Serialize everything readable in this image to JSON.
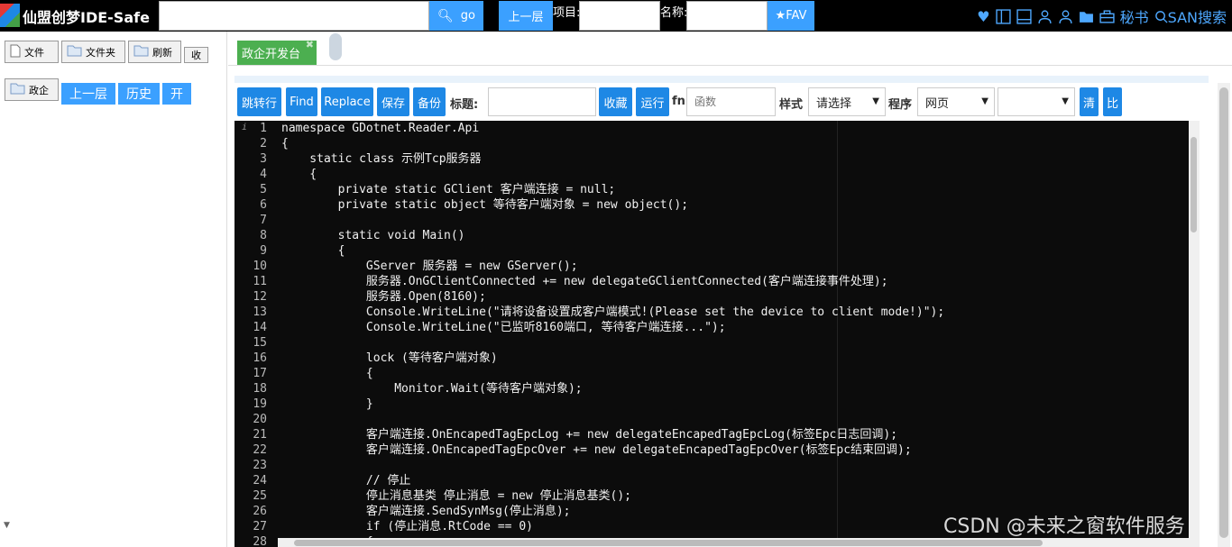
{
  "header": {
    "app_title": "仙盟创梦IDE-Safe",
    "search_value": "",
    "go_label": "go",
    "up_label": "上一层",
    "project_label": "项目:",
    "name_label": "名称:",
    "fav_label": "★FAV",
    "secretary_label": "秘书",
    "san_search_label": "SAN搜索"
  },
  "left": {
    "file_label": "文件",
    "folder_label": "文件夹",
    "refresh_label": "刷新",
    "collapse_label": "收",
    "folder_item_label": "政企",
    "up_label": "上一层",
    "history_label": "历史",
    "open_label": "开"
  },
  "tabs": [
    {
      "label": "政企开发台"
    }
  ],
  "toolbar": {
    "jump_label": "跳转行",
    "find_label": "Find",
    "replace_label": "Replace",
    "save_label": "保存",
    "backup_label": "备份",
    "title_label": "标题:",
    "collect_label": "收藏",
    "run_label": "运行",
    "fn_label": "fn",
    "fn_placeholder": "函数",
    "style_label": "样式",
    "style_value": "请选择",
    "program_label": "程序",
    "program_value": "网页",
    "clear_label": "清",
    "compare_label": "比"
  },
  "editor": {
    "lines": [
      "namespace GDotnet.Reader.Api",
      "{",
      "    static class 示例Tcp服务器",
      "    {",
      "        private static GClient 客户端连接 = null;",
      "        private static object 等待客户端对象 = new object();",
      "",
      "        static void Main()",
      "        {",
      "            GServer 服务器 = new GServer();",
      "            服务器.OnGClientConnected += new delegateGClientConnected(客户端连接事件处理);",
      "            服务器.Open(8160);",
      "            Console.WriteLine(\"请将设备设置成客户端模式!(Please set the device to client mode!)\");",
      "            Console.WriteLine(\"已监听8160端口, 等待客户端连接...\");",
      "",
      "            lock (等待客户端对象)",
      "            {",
      "                Monitor.Wait(等待客户端对象);",
      "            }",
      "",
      "            客户端连接.OnEncapedTagEpcLog += new delegateEncapedTagEpcLog(标签Epc日志回调);",
      "            客户端连接.OnEncapedTagEpcOver += new delegateEncapedTagEpcOver(标签Epc结束回调);",
      "",
      "            // 停止",
      "            停止消息基类 停止消息 = new 停止消息基类();",
      "            客户端连接.SendSynMsg(停止消息);",
      "            if (停止消息.RtCode == 0)",
      "            {"
    ],
    "line_numbers": [
      "1",
      "2",
      "3",
      "4",
      "5",
      "6",
      "7",
      "8",
      "9",
      "10",
      "11",
      "12",
      "13",
      "14",
      "15",
      "16",
      "17",
      "18",
      "19",
      "20",
      "21",
      "22",
      "23",
      "24",
      "25",
      "26",
      "27",
      "28"
    ]
  },
  "watermark": "CSDN @未来之窗软件服务",
  "colors": {
    "accent": "#3ba0ff",
    "toolbar_button": "#1e88e5",
    "tab_green": "#4caf50",
    "editor_bg": "#0c0c0c"
  }
}
